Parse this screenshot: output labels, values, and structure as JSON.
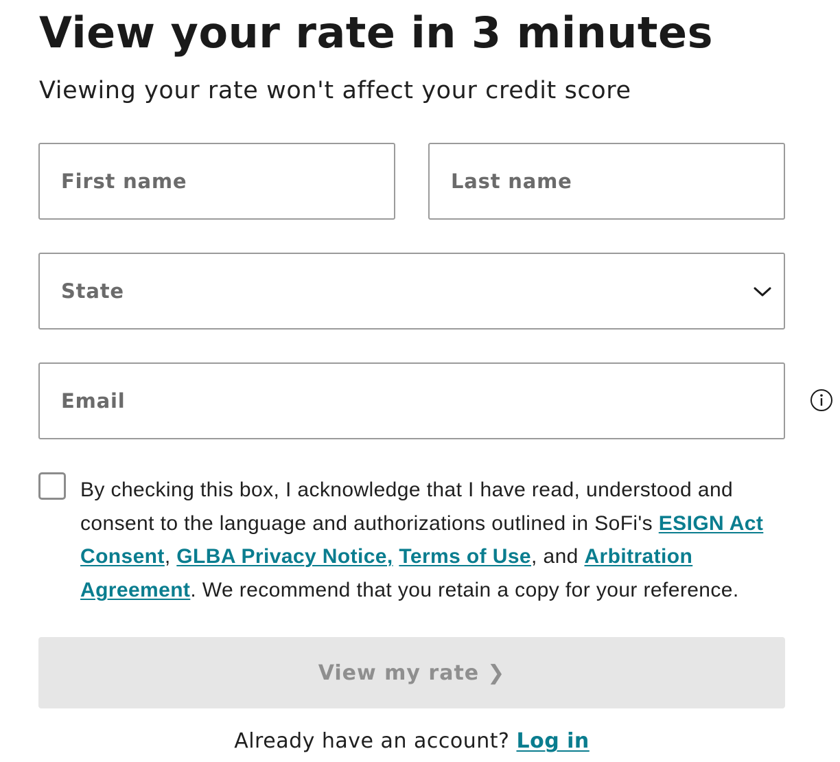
{
  "header": {
    "title": "View your rate in 3 minutes",
    "subtitle": "Viewing your rate won't affect your credit score"
  },
  "form": {
    "first_name": {
      "placeholder": "First name",
      "value": ""
    },
    "last_name": {
      "placeholder": "Last name",
      "value": ""
    },
    "state": {
      "selected": "State",
      "icon": "chevron-down-icon"
    },
    "email": {
      "placeholder": "Email",
      "value": "",
      "info_icon": "info-icon"
    },
    "consent": {
      "checked": false,
      "text_part1": "By checking this box, I acknowledge that I have read, understood and consent to the language and authorizations outlined in SoFi's ",
      "esign_link": "ESIGN Act Consent",
      "sep1": ", ",
      "glba_link": "GLBA Privacy Notice,",
      "sep2": " ",
      "terms_link": "Terms of Use",
      "sep3": ", and ",
      "arbitration_link": "Arbitration Agreement",
      "text_part2": ". We recommend that you retain a copy for your reference."
    },
    "submit": {
      "label": "View my rate",
      "chevron": "❯",
      "enabled": false
    }
  },
  "footer": {
    "prompt": "Already have an account?",
    "login_link": "Log in"
  },
  "colors": {
    "link": "#0a7d8f",
    "text": "#1a1a1a",
    "placeholder": "#6b6b6b",
    "border": "#9b9b9b",
    "button_disabled_bg": "#e6e6e6",
    "button_disabled_text": "#8f8f8f"
  }
}
